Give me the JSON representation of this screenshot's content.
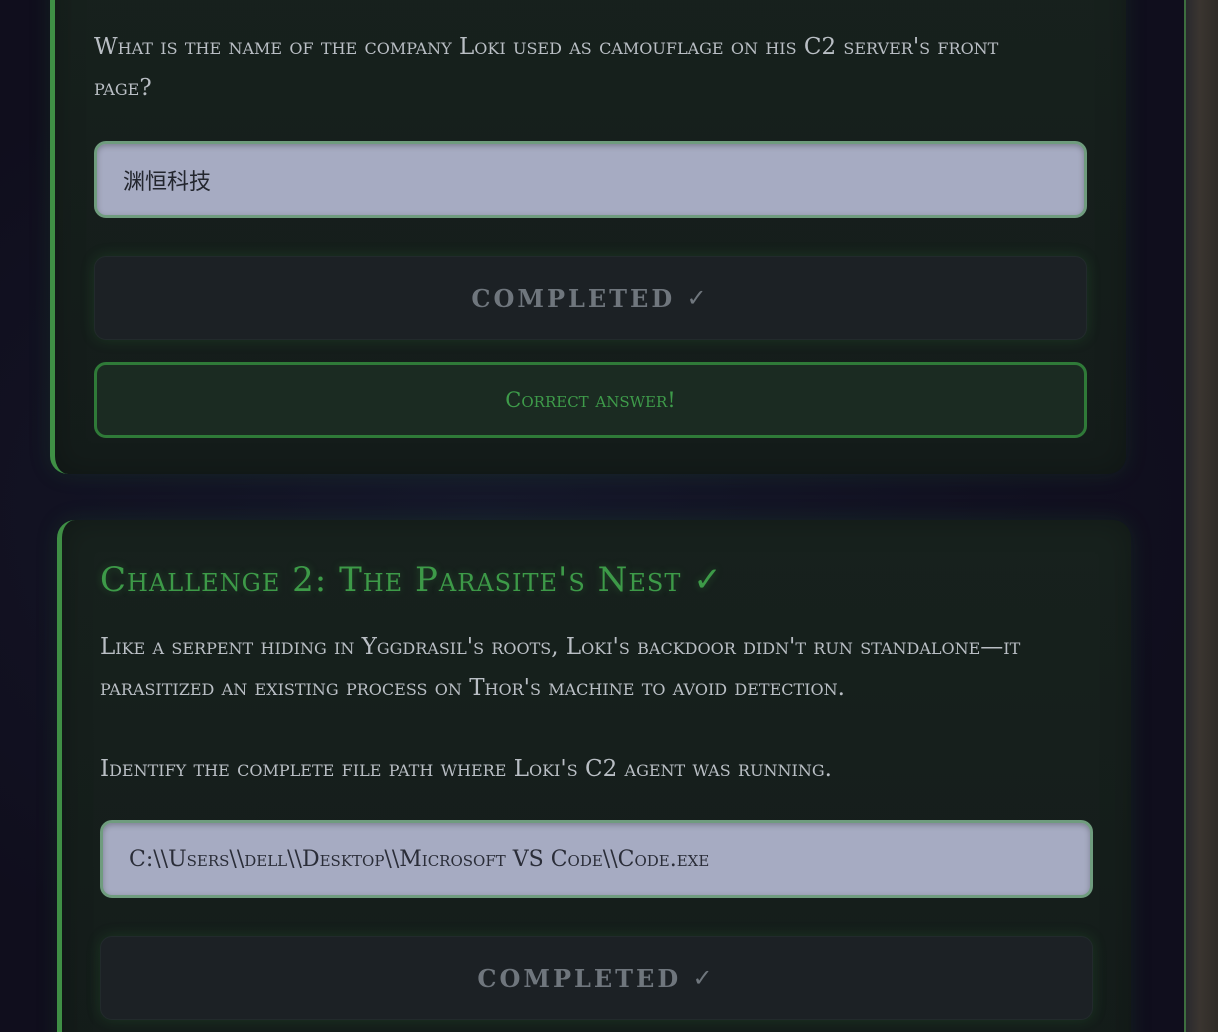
{
  "challenge1": {
    "question": "What is the name of the company Loki used as camouflage on his C2 server's front page?",
    "answer_value": "渊恒科技",
    "completed_label": "COMPLETED",
    "completed_check": "✓",
    "feedback": "Correct answer!"
  },
  "challenge2": {
    "title": "Challenge 2: The Parasite's Nest",
    "title_check": "✓",
    "description": "Like a serpent hiding in Yggdrasil's roots, Loki's backdoor didn't run standalone—it parasitized an existing process on Thor's machine to avoid detection.",
    "question": "Identify the complete file path where Loki's C2 agent was running.",
    "answer_value": "C:\\\\Users\\\\dell\\\\Desktop\\\\Microsoft VS Code\\\\Code.exe",
    "completed_label": "COMPLETED",
    "completed_check": "✓"
  },
  "colors": {
    "accent_green": "#3f8f45",
    "input_bg": "#a6abc2",
    "page_bg": "#12101f"
  }
}
